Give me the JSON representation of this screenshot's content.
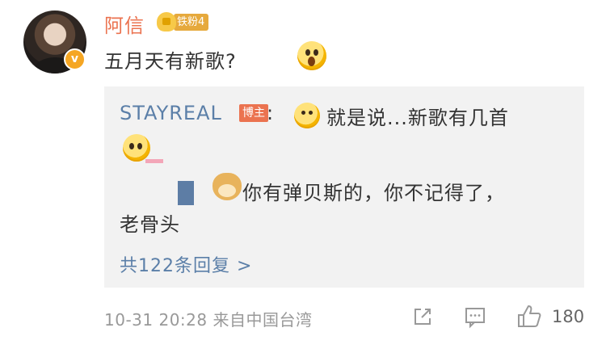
{
  "comment": {
    "username": "阿信",
    "fan_badge_label": "铁粉4",
    "text": "五月天有新歌?",
    "verified_mark": "v",
    "reply_preview": {
      "author": "STAYREAL",
      "author_tag": "博主",
      "colon": ":",
      "line1": "就是说...新歌有几首",
      "line2": "你有弹贝斯的，你不记得了，",
      "line3": "老骨头",
      "more_link": "共122条回复 >"
    },
    "meta": "10-31 20:28 来自中国台湾",
    "like_count": "180"
  },
  "colors": {
    "username": "#eb7350",
    "link": "#5b7fa8",
    "reply_bg": "#f2f2f2",
    "meta": "#999999"
  },
  "icons": [
    "share-icon",
    "comment-icon",
    "like-icon",
    "verified-badge-icon",
    "fan-badge-icon"
  ]
}
